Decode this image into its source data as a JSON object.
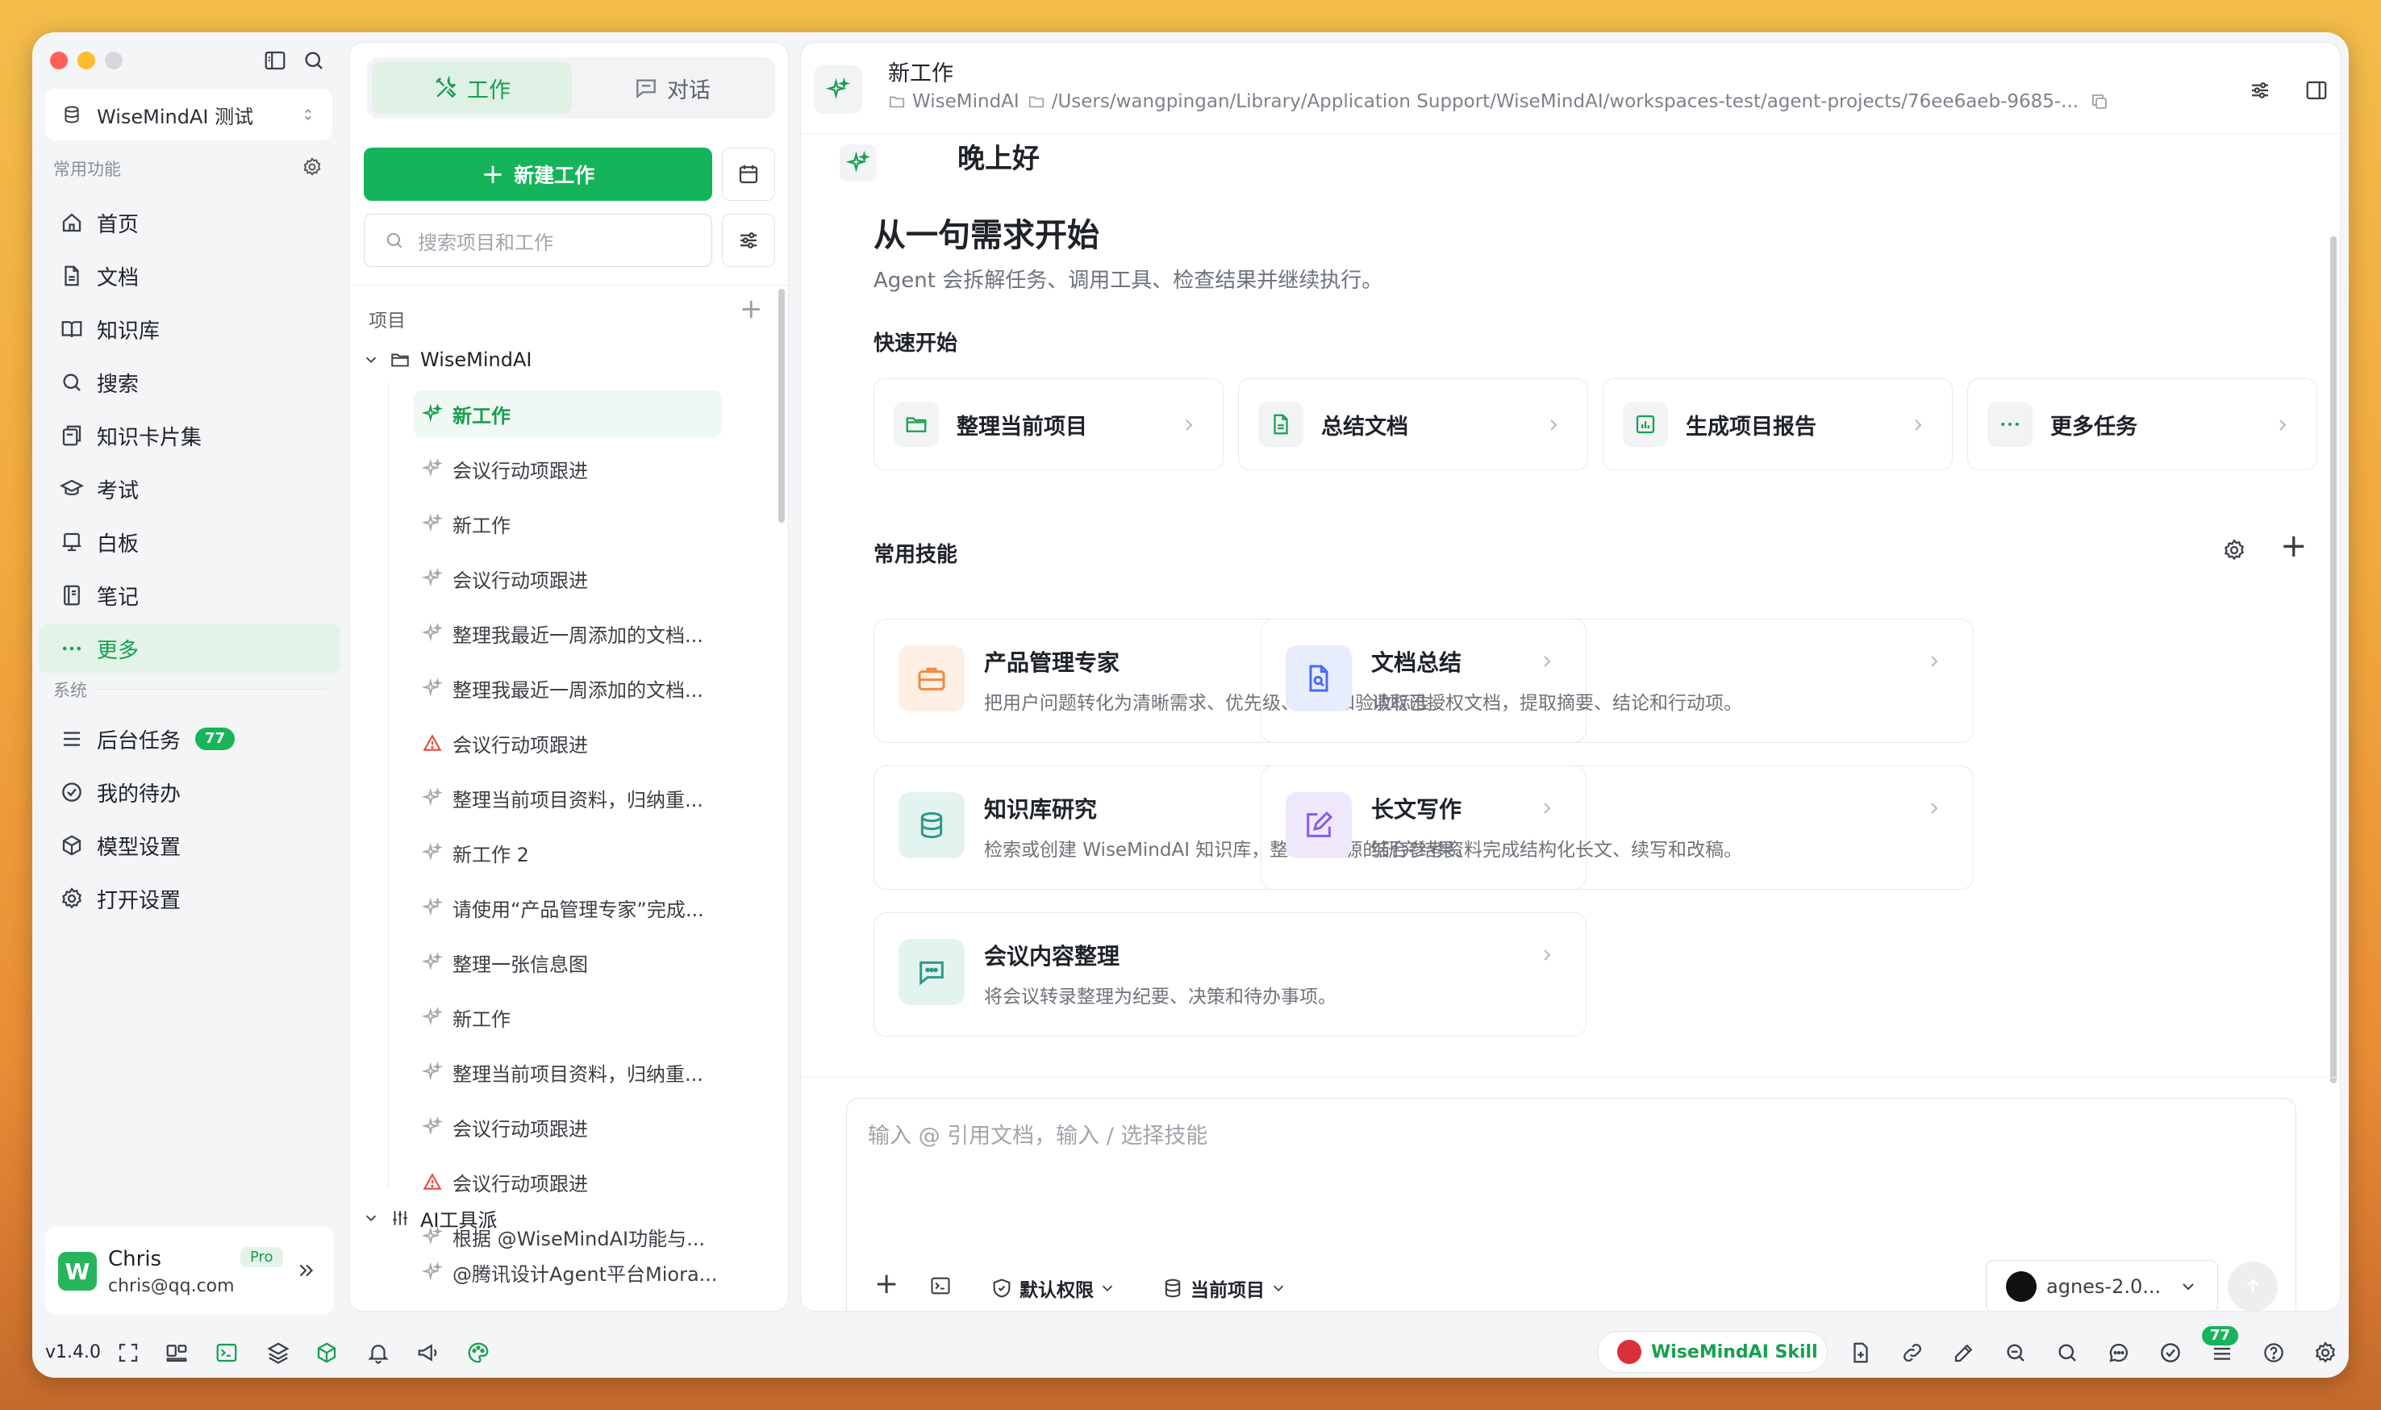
{
  "app": {
    "version": "v1.4.0"
  },
  "sidebar": {
    "workspace": "WiseMindAI 测试",
    "section_common": "常用功能",
    "section_system": "系统",
    "items": [
      {
        "label": "首页",
        "icon": "home-icon"
      },
      {
        "label": "文档",
        "icon": "document-icon"
      },
      {
        "label": "知识库",
        "icon": "book-icon"
      },
      {
        "label": "搜索",
        "icon": "search-icon"
      },
      {
        "label": "知识卡片集",
        "icon": "cards-icon"
      },
      {
        "label": "考试",
        "icon": "graduation-cap-icon"
      },
      {
        "label": "白板",
        "icon": "whiteboard-icon"
      },
      {
        "label": "笔记",
        "icon": "notebook-icon"
      },
      {
        "label": "更多",
        "icon": "more-icon"
      }
    ],
    "system_items": [
      {
        "label": "后台任务",
        "icon": "list-icon",
        "badge": "77"
      },
      {
        "label": "我的待办",
        "icon": "check-circle-icon"
      },
      {
        "label": "模型设置",
        "icon": "cube-icon"
      },
      {
        "label": "打开设置",
        "icon": "gear-icon"
      }
    ],
    "user": {
      "name": "Chris",
      "email": "chris@qq.com",
      "plan": "Pro",
      "avatar_letter": "W"
    }
  },
  "panel": {
    "tab_work": "工作",
    "tab_chat": "对话",
    "new_work": "新建工作",
    "search_placeholder": "搜索项目和工作",
    "projects_label": "项目",
    "project_name": "WiseMindAI",
    "items": [
      {
        "label": "新工作",
        "state": "active"
      },
      {
        "label": "会议行动项跟进",
        "state": "normal"
      },
      {
        "label": "新工作",
        "state": "normal"
      },
      {
        "label": "会议行动项跟进",
        "state": "normal"
      },
      {
        "label": "整理我最近一周添加的文档...",
        "state": "normal"
      },
      {
        "label": "整理我最近一周添加的文档...",
        "state": "normal"
      },
      {
        "label": "会议行动项跟进",
        "state": "warn"
      },
      {
        "label": "整理当前项目资料，归纳重...",
        "state": "normal"
      },
      {
        "label": "新工作 2",
        "state": "normal"
      },
      {
        "label": "请使用“产品管理专家”完成...",
        "state": "normal"
      },
      {
        "label": "整理一张信息图",
        "state": "normal"
      },
      {
        "label": "新工作",
        "state": "normal"
      },
      {
        "label": "整理当前项目资料，归纳重...",
        "state": "normal"
      },
      {
        "label": "会议行动项跟进",
        "state": "normal"
      },
      {
        "label": "会议行动项跟进",
        "state": "warn"
      },
      {
        "label": "根据 @WiseMindAI功能与...",
        "state": "normal"
      }
    ],
    "group2_name": "AI工具派",
    "group2_item": "@腾讯设计Agent平台Miora..."
  },
  "main": {
    "header_title": "新工作",
    "path_workspace": "WiseMindAI",
    "path": "/Users/wangpingan/Library/Application Support/WiseMindAI/workspaces-test/agent-projects/76ee6aeb-9685-...",
    "greeting": "晚上好",
    "headline": "从一句需求开始",
    "subline": "Agent 会拆解任务、调用工具、检查结果并继续执行。",
    "quick_label": "快速开始",
    "quick": [
      {
        "label": "整理当前项目",
        "icon": "folder-icon"
      },
      {
        "label": "总结文档",
        "icon": "document-icon"
      },
      {
        "label": "生成项目报告",
        "icon": "chart-icon"
      },
      {
        "label": "更多任务",
        "icon": "more-icon"
      }
    ],
    "skills_label": "常用技能",
    "skills": [
      {
        "title": "产品管理专家",
        "desc": "把用户问题转化为清晰需求、优先级、方案和验收标准。",
        "icon": "briefcase-icon",
        "color": "#f08a3e",
        "bg": "#fdefe3"
      },
      {
        "title": "文档总结",
        "desc": "读取已授权文档，提取摘要、结论和行动项。",
        "icon": "doc-search-icon",
        "color": "#4a6cf0",
        "bg": "#e8edfd"
      },
      {
        "title": "知识库研究",
        "desc": "检索或创建 WiseMindAI 知识库，整理带来源的研究结果。",
        "icon": "database-icon",
        "color": "#2b9a8a",
        "bg": "#e3f3f0"
      },
      {
        "title": "长文写作",
        "desc": "结合参考资料完成结构化长文、续写和改稿。",
        "icon": "pen-icon",
        "color": "#8b5ce8",
        "bg": "#efe8fd"
      },
      {
        "title": "会议内容整理",
        "desc": "将会议转录整理为纪要、决策和待办事项。",
        "icon": "chat-icon",
        "color": "#2b9a8a",
        "bg": "#e3f3f0"
      }
    ],
    "input_placeholder": "输入 @ 引用文档，输入 / 选择技能",
    "permission": "默认权限",
    "scope": "当前项目",
    "model": "agnes-2.0..."
  },
  "statusbar": {
    "skill_button": "WiseMindAI Skill",
    "badge": "77"
  },
  "colors": {
    "accent": "#16b45a",
    "warn": "#e5483b"
  }
}
